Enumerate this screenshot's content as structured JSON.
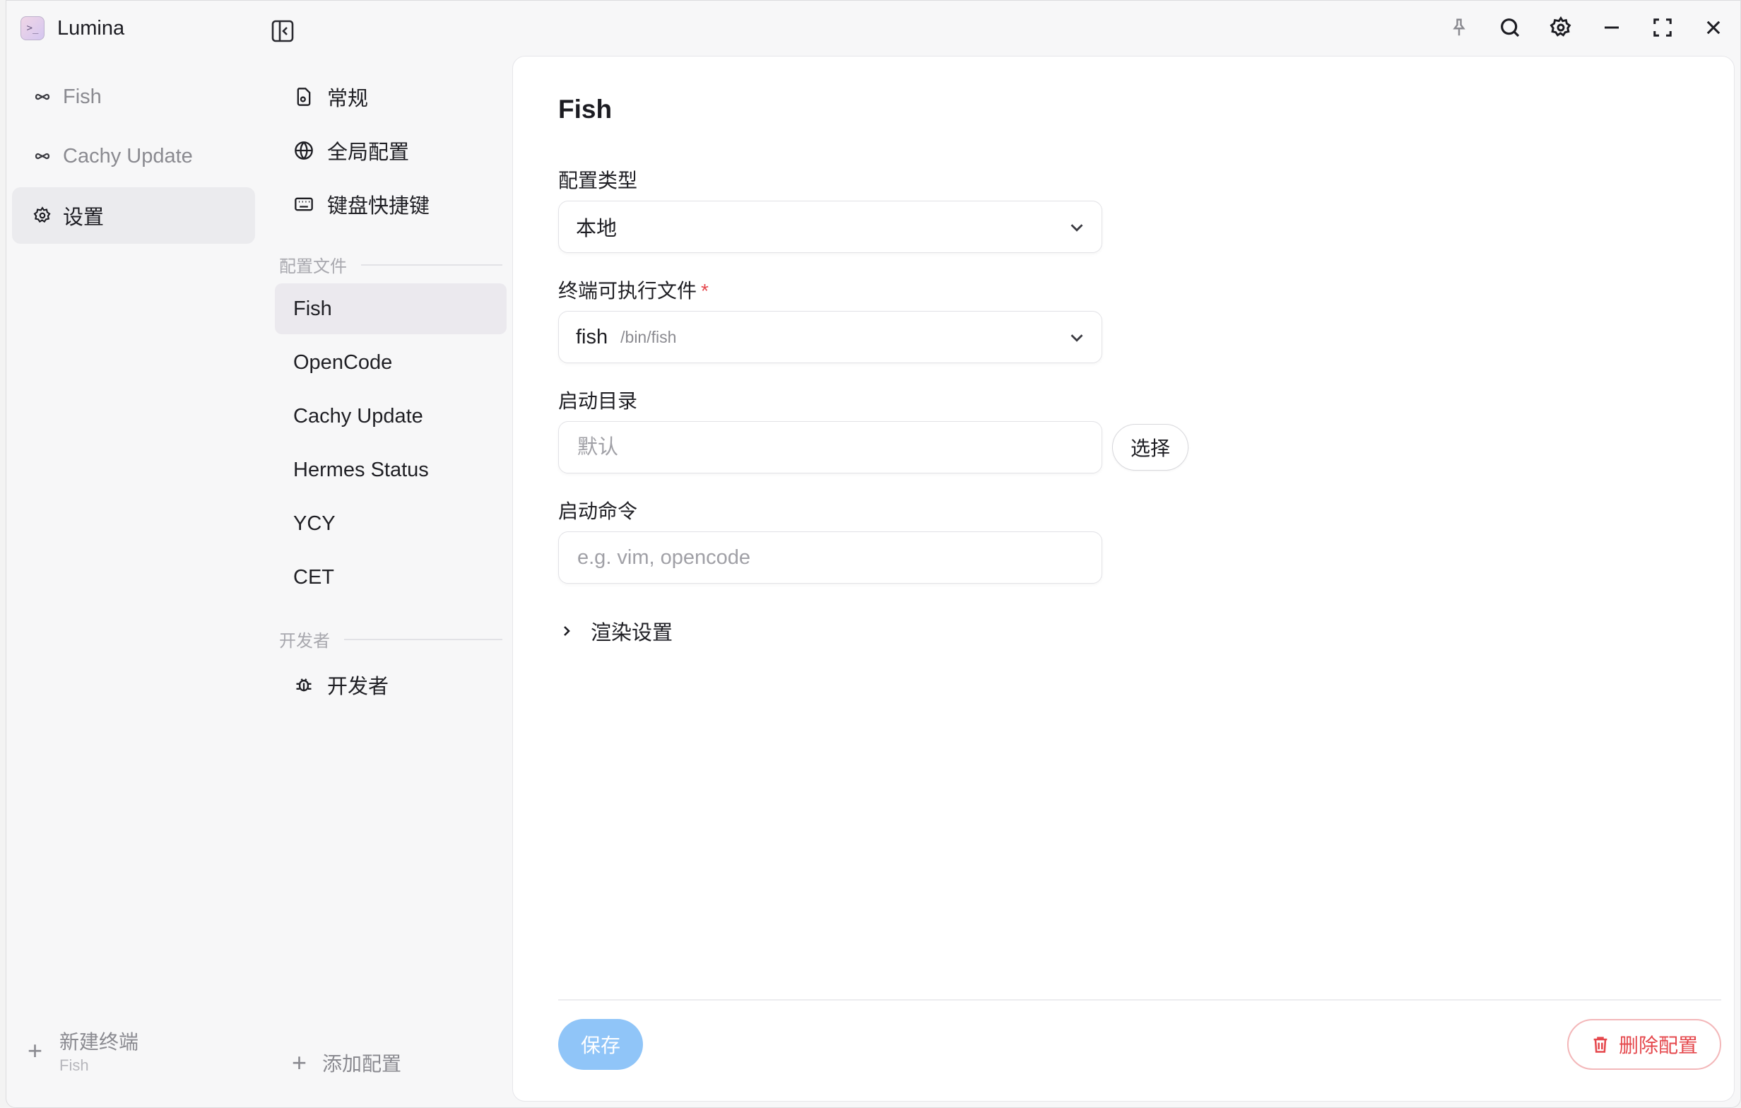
{
  "app": {
    "title": "Lumina",
    "logo_glyph": ">_"
  },
  "sidebar": {
    "items": [
      {
        "label": "Fish",
        "icon": "infinity-icon"
      },
      {
        "label": "Cachy Update",
        "icon": "infinity-icon"
      },
      {
        "label": "设置",
        "icon": "gear-icon",
        "active": true
      }
    ],
    "new_terminal": {
      "label": "新建终端",
      "sub": "Fish"
    }
  },
  "settings_nav": {
    "general": [
      {
        "label": "常规",
        "icon": "file-settings-icon"
      },
      {
        "label": "全局配置",
        "icon": "globe-icon"
      },
      {
        "label": "键盘快捷键",
        "icon": "keyboard-icon"
      }
    ],
    "profiles_header": "配置文件",
    "profiles": [
      "Fish",
      "OpenCode",
      "Cachy Update",
      "Hermes Status",
      "YCY",
      "CET"
    ],
    "developer_header": "开发者",
    "developer_item": "开发者",
    "add_config": "添加配置"
  },
  "main": {
    "title": "Fish",
    "config_type": {
      "label": "配置类型",
      "value": "本地"
    },
    "executable": {
      "label": "终端可执行文件",
      "required_mark": "*",
      "value": "fish",
      "path": "/bin/fish"
    },
    "start_dir": {
      "label": "启动目录",
      "placeholder": "默认",
      "choose_label": "选择"
    },
    "start_cmd": {
      "label": "启动命令",
      "placeholder": "e.g. vim, opencode"
    },
    "render_settings": "渲染设置",
    "save_label": "保存",
    "delete_label": "删除配置"
  },
  "colors": {
    "accent": "#90c5f8",
    "danger": "#e5484d"
  }
}
